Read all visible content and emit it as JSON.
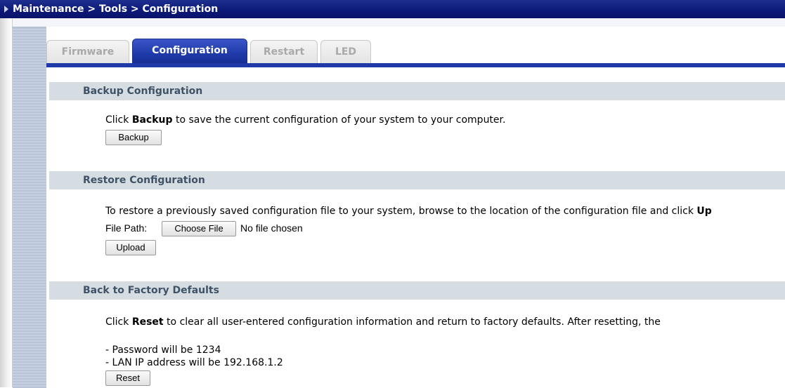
{
  "titlebar": {
    "breadcrumb": "Maintenance > Tools > Configuration",
    "icon": "arrow-icon"
  },
  "tabs": [
    {
      "label": "Firmware",
      "active": false
    },
    {
      "label": "Configuration",
      "active": true
    },
    {
      "label": "Restart",
      "active": false
    },
    {
      "label": "LED",
      "active": false
    }
  ],
  "backup": {
    "header": "Backup Configuration",
    "text_before": "Click ",
    "text_bold": "Backup",
    "text_after": " to save the current configuration of your system to your computer.",
    "button": "Backup"
  },
  "restore": {
    "header": "Restore Configuration",
    "text_before": "To restore a previously saved configuration file to your system, browse to the location of the configuration file and click ",
    "text_bold": "Up",
    "file_path_label": "File Path:",
    "choose_button": "Choose File",
    "file_status": "No file chosen",
    "upload_button": "Upload"
  },
  "factory": {
    "header": "Back to Factory Defaults",
    "text_before": "Click ",
    "text_bold": "Reset",
    "text_after": " to clear all user-entered configuration information and return to factory defaults. After resetting, the",
    "line1": "- Password will be 1234",
    "line2": "- LAN IP address will be 192.168.1.2",
    "reset_button": "Reset"
  },
  "colors": {
    "titlebar": "#0d1a78",
    "active_tab": "#1f3aa8",
    "section_header_bg": "#d5dde3",
    "section_header_text": "#3f5266"
  }
}
